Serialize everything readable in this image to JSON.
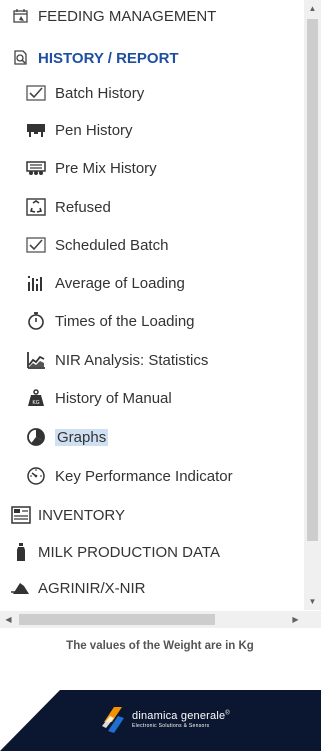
{
  "menu": {
    "feeding_management": "FEEDING MANAGEMENT",
    "history_report": "HISTORY / REPORT",
    "history_items": [
      {
        "label": "Batch History",
        "icon": "batch-checkbox-icon"
      },
      {
        "label": "Pen History",
        "icon": "cow-icon"
      },
      {
        "label": "Pre Mix History",
        "icon": "mixer-wagon-icon"
      },
      {
        "label": "Refused",
        "icon": "refused-icon"
      },
      {
        "label": "Scheduled Batch",
        "icon": "scheduled-checkbox-icon"
      },
      {
        "label": "Average of Loading",
        "icon": "bar-average-icon"
      },
      {
        "label": "Times of the Loading",
        "icon": "stopwatch-icon"
      },
      {
        "label": "NIR Analysis: Statistics",
        "icon": "line-chart-icon"
      },
      {
        "label": "History of Manual",
        "icon": "weight-kg-icon"
      },
      {
        "label": "Graphs",
        "icon": "pie-chart-icon"
      },
      {
        "label": "Key Performance Indicator",
        "icon": "gauge-icon"
      }
    ],
    "inventory": "INVENTORY",
    "milk_production": "MILK PRODUCTION DATA",
    "agrinir": "AGRINIR/X-NIR",
    "selected": "Graphs"
  },
  "footer": {
    "weight_note": "The values of the Weight are in Kg",
    "brand_name": "dinamica generale",
    "brand_mark": "®",
    "brand_tagline": "Electronic Solutions & Sensors"
  },
  "colors": {
    "active_header": "#1f4fa0",
    "selected_bg": "#cfe0f2",
    "brand_bg": "#0b1730",
    "brand_accent_orange": "#f39200",
    "brand_accent_blue": "#1f6fd1"
  }
}
